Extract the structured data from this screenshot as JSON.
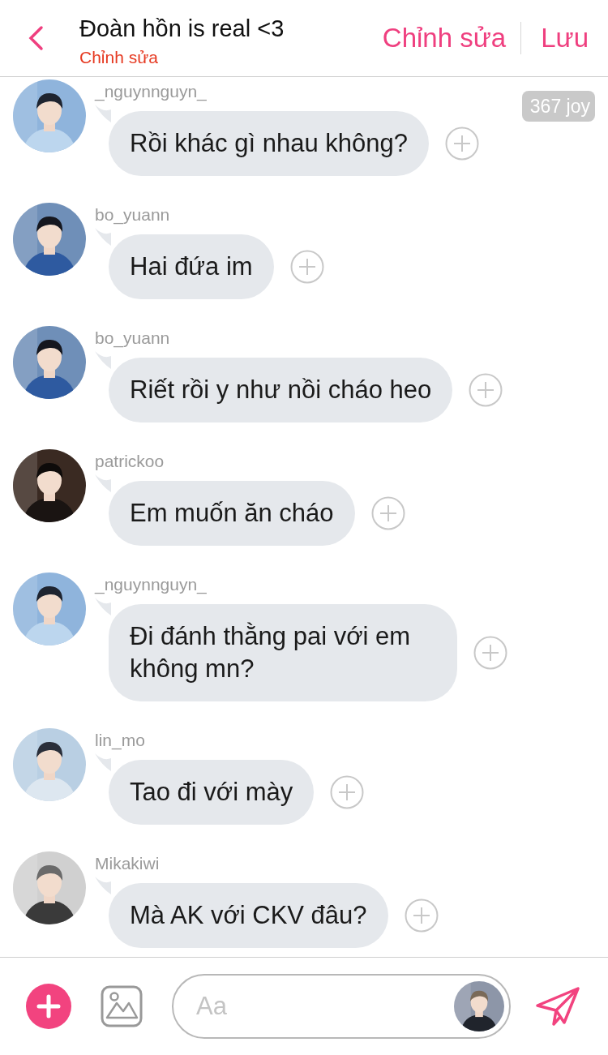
{
  "header": {
    "title": "Đoàn hồn is real <3",
    "subtitle": "Chỉnh sửa",
    "actions": [
      "Chỉnh sửa",
      "Lưu"
    ]
  },
  "badge": "367 joy",
  "messages": [
    {
      "user": "_nguynnguyn_",
      "text": "Rồi khác gì nhau không?"
    },
    {
      "user": "bo_yuann",
      "text": "Hai đứa im"
    },
    {
      "user": "bo_yuann",
      "text": "Riết rồi y như nồi cháo heo"
    },
    {
      "user": "patrickoo",
      "text": "Em muốn ăn cháo"
    },
    {
      "user": "_nguynnguyn_",
      "text": "Đi đánh thằng pai với em không mn?"
    },
    {
      "user": "lin_mo",
      "text": "Tao đi với mày"
    },
    {
      "user": "Mikakiwi",
      "text": "Mà AK với CKV đâu?"
    }
  ],
  "composer": {
    "placeholder": "Aa"
  }
}
